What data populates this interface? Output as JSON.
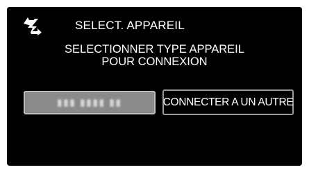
{
  "screen": {
    "title": "SELECT. APPAREIL",
    "message_line1": "SELECTIONNER TYPE APPAREIL",
    "message_line2": "POUR CONNEXION",
    "header_icon": "wireless-transfer-icon"
  },
  "buttons": {
    "device_label": "▮▮▮ ▮▮▮▮ ▮▮",
    "connect_other_label": "CONNECTER A UN AUTRE"
  },
  "colors": {
    "background": "#000000",
    "text": "#ffffff",
    "device_button_fill": "#8a8a8a",
    "button_border": "#9a9a9a"
  }
}
